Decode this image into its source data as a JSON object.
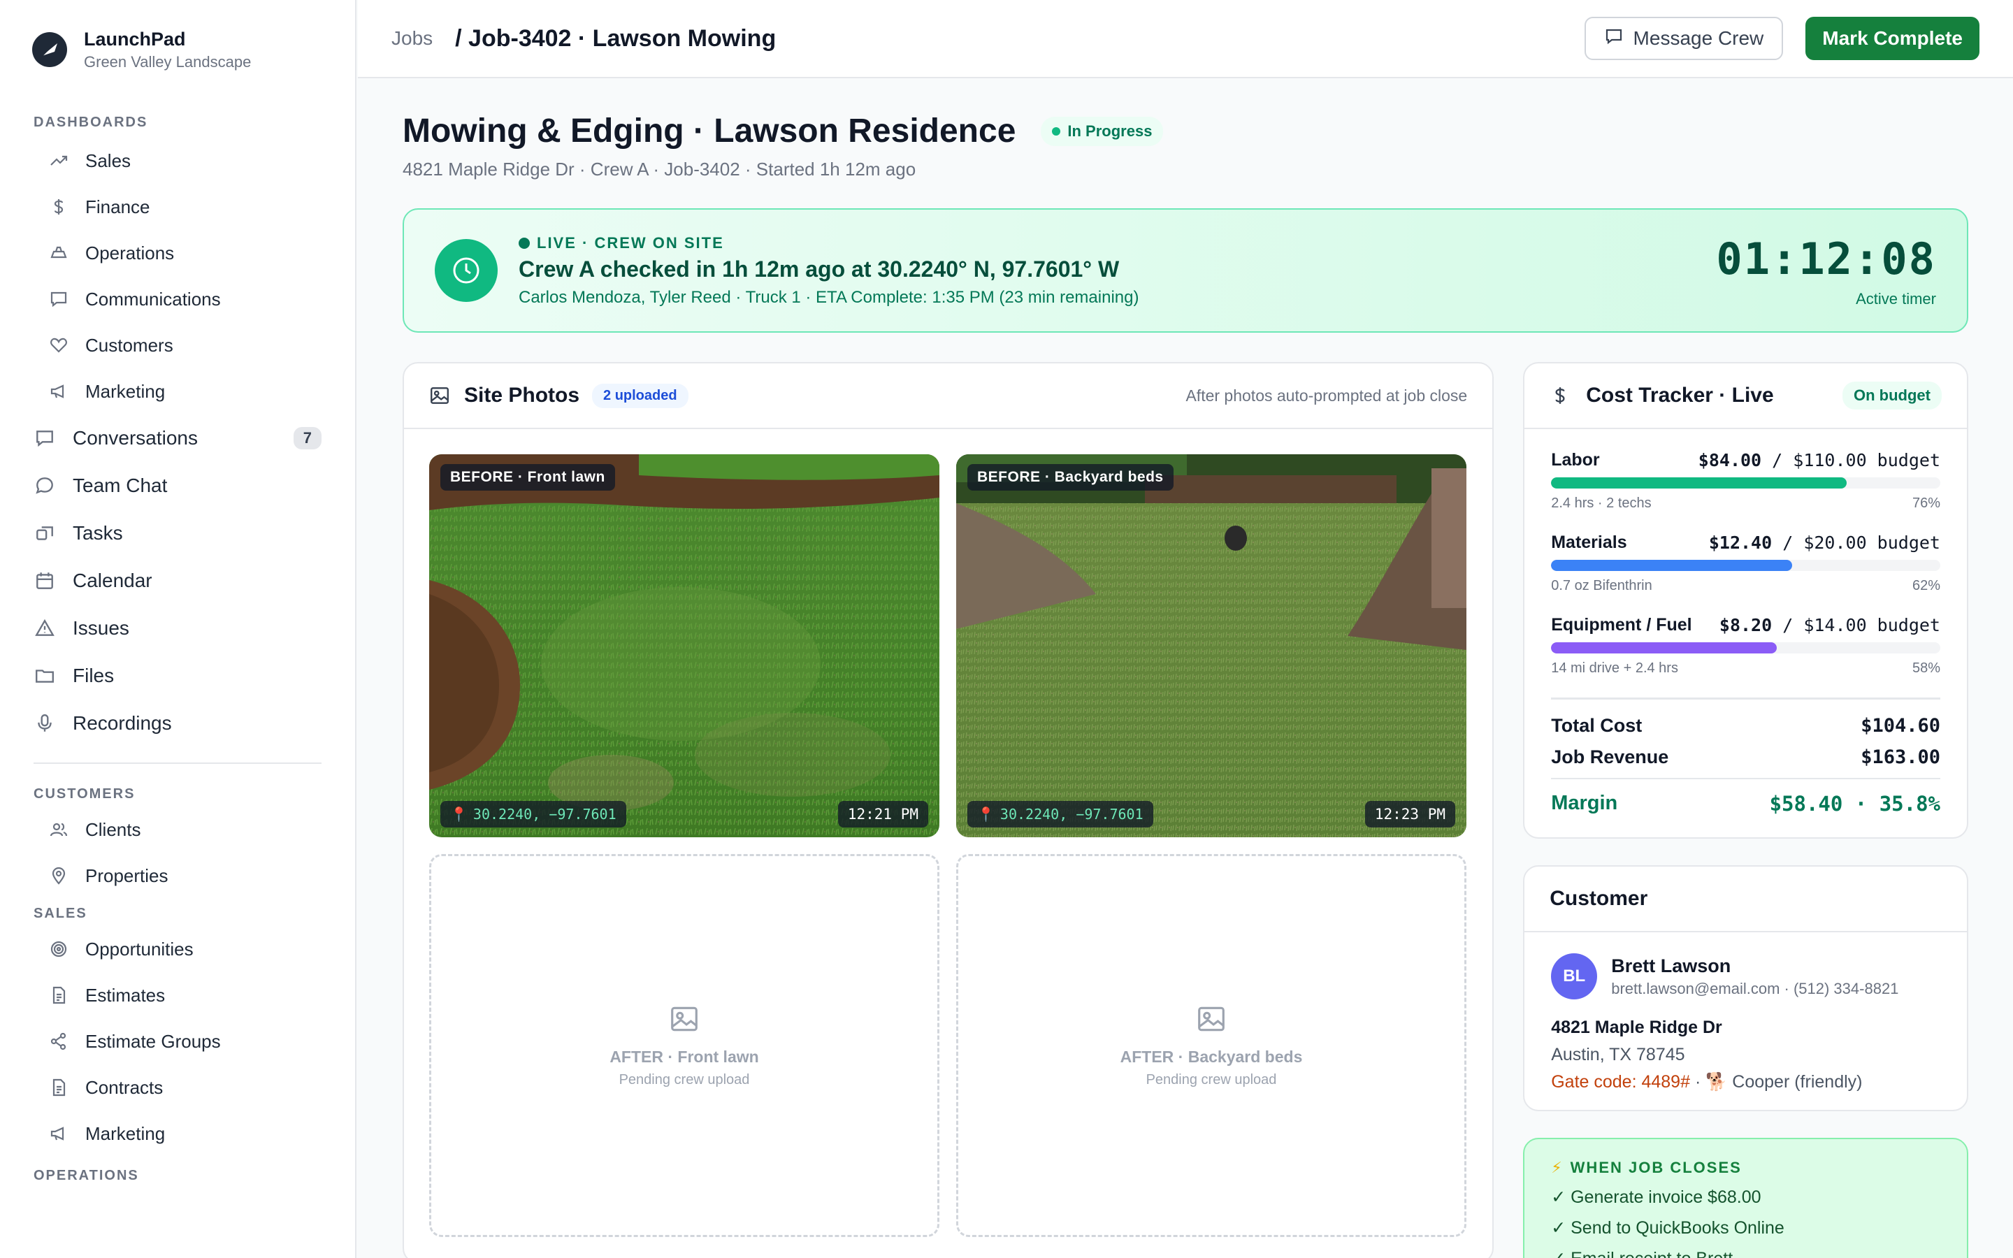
{
  "app": {
    "name": "LaunchPad",
    "org": "Green Valley Landscape"
  },
  "sidebar": {
    "dashboards_label": "DASHBOARDS",
    "dashboards": [
      {
        "label": "Sales",
        "icon": "trend-icon"
      },
      {
        "label": "Finance",
        "icon": "dollar-icon"
      },
      {
        "label": "Operations",
        "icon": "operations-icon"
      },
      {
        "label": "Communications",
        "icon": "chat-icon"
      },
      {
        "label": "Customers",
        "icon": "heart-icon"
      },
      {
        "label": "Marketing",
        "icon": "megaphone-icon"
      }
    ],
    "top": [
      {
        "label": "Conversations",
        "icon": "chat-icon",
        "badge": "7"
      },
      {
        "label": "Team Chat",
        "icon": "bubble-icon"
      },
      {
        "label": "Tasks",
        "icon": "tasks-icon"
      },
      {
        "label": "Calendar",
        "icon": "calendar-icon"
      },
      {
        "label": "Issues",
        "icon": "warning-icon"
      },
      {
        "label": "Files",
        "icon": "folder-icon"
      },
      {
        "label": "Recordings",
        "icon": "mic-icon"
      }
    ],
    "customers_label": "CUSTOMERS",
    "customers": [
      {
        "label": "Clients",
        "icon": "users-icon"
      },
      {
        "label": "Properties",
        "icon": "pin-icon"
      }
    ],
    "sales_label": "SALES",
    "sales": [
      {
        "label": "Opportunities",
        "icon": "target-icon"
      },
      {
        "label": "Estimates",
        "icon": "document-icon"
      },
      {
        "label": "Estimate Groups",
        "icon": "share-icon"
      },
      {
        "label": "Contracts",
        "icon": "document-icon"
      },
      {
        "label": "Marketing",
        "icon": "megaphone-icon"
      }
    ],
    "operations_label": "OPERATIONS"
  },
  "header": {
    "crumb_root": "Jobs",
    "crumb_current": "/ Job-3402 · Lawson Mowing",
    "message_crew": "Message Crew",
    "mark_complete": "Mark Complete"
  },
  "job": {
    "title": "Mowing & Edging · Lawson Residence",
    "status": "In Progress",
    "subtitle": "4821 Maple Ridge Dr · Crew A · Job-3402 · Started 1h 12m ago"
  },
  "live": {
    "tag": "LIVE · CREW ON SITE",
    "title": "Crew A checked in 1h 12m ago at 30.2240° N, 97.7601° W",
    "detail": "Carlos Mendoza, Tyler Reed · Truck 1 · ETA Complete: 1:35 PM (23 min remaining)",
    "timer": "01:12:08",
    "timer_label": "Active timer"
  },
  "photos": {
    "title": "Site Photos",
    "count": "2 uploaded",
    "hint": "After photos auto-prompted at job close",
    "before": [
      {
        "label": "BEFORE · Front lawn",
        "gps": "30.2240, −97.7601",
        "time": "12:21 PM"
      },
      {
        "label": "BEFORE · Backyard beds",
        "gps": "30.2240, −97.7601",
        "time": "12:23 PM"
      }
    ],
    "after": [
      {
        "label": "AFTER · Front lawn",
        "sub": "Pending crew upload"
      },
      {
        "label": "AFTER · Backyard beds",
        "sub": "Pending crew upload"
      }
    ]
  },
  "cost": {
    "title": "Cost Tracker · Live",
    "badge": "On budget",
    "rows": [
      {
        "name": "Labor",
        "spent": "$84.00",
        "budget": "/ $110.00 budget",
        "detail": "2.4 hrs · 2 techs",
        "pct_label": "76%",
        "pct": 76,
        "color": "#10b981"
      },
      {
        "name": "Materials",
        "spent": "$12.40",
        "budget": "/ $20.00 budget",
        "detail": "0.7 oz Bifenthrin",
        "pct_label": "62%",
        "pct": 62,
        "color": "#3b82f6"
      },
      {
        "name": "Equipment / Fuel",
        "spent": "$8.20",
        "budget": "/ $14.00 budget",
        "detail": "14 mi drive + 2.4 hrs",
        "pct_label": "58%",
        "pct": 58,
        "color": "#8b5cf6"
      }
    ],
    "total_label": "Total Cost",
    "total_value": "$104.60",
    "revenue_label": "Job Revenue",
    "revenue_value": "$163.00",
    "margin_label": "Margin",
    "margin_value": "$58.40 · 35.8%"
  },
  "customer": {
    "title": "Customer",
    "initials": "BL",
    "name": "Brett Lawson",
    "contact": "brett.lawson@email.com · (512) 334-8821",
    "address1": "4821 Maple Ridge Dr",
    "address2": "Austin, TX 78745",
    "gate": "Gate code: 4489#",
    "pet": " · 🐕 Cooper (friendly)"
  },
  "on_close": {
    "title": "WHEN JOB CLOSES",
    "items": [
      "✓ Generate invoice $68.00",
      "✓ Send to QuickBooks Online",
      "✓ Email receipt to Brett"
    ]
  }
}
